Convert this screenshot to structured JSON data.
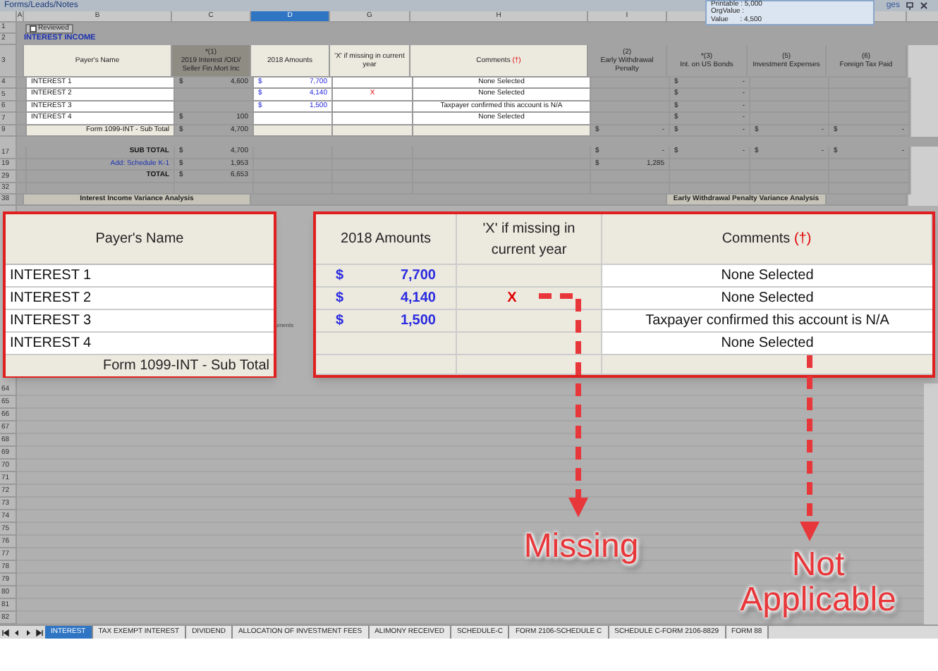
{
  "title_bar": {
    "title": "Forms/Leads/Notes",
    "right_text": "ges"
  },
  "tooltip": {
    "lines": [
      "Printable : 5,000",
      "OrgValue :",
      "Value      : 4,500"
    ]
  },
  "column_headers": [
    {
      "label": "A",
      "selected": false
    },
    {
      "label": "B",
      "selected": false
    },
    {
      "label": "C",
      "selected": false
    },
    {
      "label": "D",
      "selected": true
    },
    {
      "label": "G",
      "selected": false
    },
    {
      "label": "H",
      "selected": false
    },
    {
      "label": "I",
      "selected": false
    }
  ],
  "reviewed": {
    "number": "1",
    "label": "Reviewed",
    "checked": false
  },
  "section_title": {
    "number": "2",
    "text": "INTEREST INCOME"
  },
  "sheet_header": {
    "number": "3",
    "payer": [
      "Payer's Name"
    ],
    "interest_2019": [
      "*(1)",
      "2019 Interest /OID/",
      "Seller Fin.Mort Inc"
    ],
    "amount_2018": [
      "2018 Amounts"
    ],
    "missing": [
      "'X' if missing in current",
      "year"
    ],
    "comment": [
      "Comments"
    ],
    "comment_marker": "(†)",
    "early_withdrawal": [
      "(2)",
      "Early Withdrawal Penalty"
    ],
    "us_bonds": [
      "*(3)",
      "Int. on US Bonds"
    ],
    "investment_expenses": [
      "(5)",
      "Investment Expenses"
    ],
    "foreign_tax": [
      "(6)",
      "Foreign Tax Paid"
    ]
  },
  "sheet_rows": [
    {
      "number": "4",
      "kind": "payer",
      "payer": "INTEREST 1",
      "interest_2019": {
        "cur": "$",
        "amt": "4,600"
      },
      "amount_2018": {
        "cur": "$",
        "amt": "7,700"
      },
      "comment": "None Selected",
      "us_bonds": {
        "cur": "$",
        "amt": "-"
      }
    },
    {
      "number": "5",
      "kind": "payer",
      "payer": "INTEREST 2",
      "amount_2018": {
        "cur": "$",
        "amt": "4,140"
      },
      "missing": "X",
      "comment": "None Selected",
      "us_bonds": {
        "cur": "$",
        "amt": "-"
      }
    },
    {
      "number": "6",
      "kind": "payer",
      "payer": "INTEREST 3",
      "amount_2018": {
        "cur": "$",
        "amt": "1,500"
      },
      "comment": "Taxpayer confirmed this account is N/A",
      "us_bonds": {
        "cur": "$",
        "amt": "-"
      }
    },
    {
      "number": "7",
      "kind": "payer",
      "payer": "INTEREST 4",
      "interest_2019": {
        "cur": "$",
        "amt": "100"
      },
      "comment": "None Selected",
      "us_bonds": {
        "cur": "$",
        "amt": "-"
      }
    },
    {
      "number": "9",
      "kind": "form_subtotal",
      "payer": "Form 1099-INT - Sub Total",
      "interest_2019": {
        "cur": "$",
        "amt": "4,700"
      },
      "early_withdrawal": {
        "cur": "$",
        "amt": "-"
      },
      "us_bonds": {
        "cur": "$",
        "amt": "-"
      },
      "investment_expenses": {
        "cur": "$",
        "amt": "-"
      },
      "foreign_tax": {
        "cur": "$",
        "amt": "-"
      }
    },
    {
      "number": "17",
      "kind": "total",
      "payer": "SUB TOTAL",
      "interest_2019": {
        "cur": "$",
        "amt": "4,700"
      },
      "early_withdrawal": {
        "cur": "$",
        "amt": "-"
      },
      "us_bonds": {
        "cur": "$",
        "amt": "-"
      },
      "investment_expenses": {
        "cur": "$",
        "amt": "-"
      },
      "foreign_tax": {
        "cur": "$",
        "amt": "-"
      }
    },
    {
      "number": "19",
      "kind": "link",
      "payer": "Add: Schedule K-1",
      "interest_2019": {
        "cur": "$",
        "amt": "1,953"
      },
      "early_withdrawal": {
        "cur": "$",
        "amt": "1,285"
      }
    },
    {
      "number": "29",
      "kind": "total",
      "payer": "TOTAL",
      "interest_2019": {
        "cur": "$",
        "amt": "6,653"
      }
    },
    {
      "number": "32",
      "kind": "blank"
    },
    {
      "number": "38",
      "kind": "section",
      "left_heading": "Interest Income Variance Analysis",
      "right_heading": "Early Withdrawal Penalty Variance Analysis"
    }
  ],
  "partial_cell_text": "uments",
  "callout_left": {
    "header": "Payer's Name",
    "rows": [
      "INTEREST 1",
      "INTEREST 2",
      "INTEREST 3",
      "INTEREST 4"
    ],
    "footer": "Form 1099-INT - Sub Total"
  },
  "callout_right": {
    "headers": [
      {
        "text": "2018 Amounts"
      },
      {
        "text": "'X' if missing in current year"
      },
      {
        "text": "Comments",
        "marker": "(†)"
      }
    ],
    "rows": [
      {
        "cur": "$",
        "amt": "7,700",
        "comment": "None Selected"
      },
      {
        "cur": "$",
        "amt": "4,140",
        "missing": "X",
        "comment": "None Selected"
      },
      {
        "cur": "$",
        "amt": "1,500",
        "comment": "Taxpayer confirmed this account is N/A"
      },
      {
        "comment": "None Selected"
      },
      {}
    ]
  },
  "annotations": [
    {
      "kind": "elbow",
      "text": "Missing"
    },
    {
      "kind": "straight",
      "text": "Not Applicable"
    }
  ],
  "bottom_row_numbers": [
    "64",
    "65",
    "66",
    "67",
    "68",
    "69",
    "70",
    "71",
    "72",
    "73",
    "74",
    "75",
    "76",
    "77",
    "78",
    "79",
    "80",
    "81",
    "82"
  ],
  "sheet_tabs": [
    {
      "label": "INTEREST",
      "selected": true
    },
    {
      "label": "TAX EXEMPT INTEREST",
      "selected": false
    },
    {
      "label": "DIVIDEND",
      "selected": false
    },
    {
      "label": "ALLOCATION OF INVESTMENT FEES",
      "selected": false
    },
    {
      "label": "ALIMONY RECEIVED",
      "selected": false
    },
    {
      "label": "SCHEDULE-C",
      "selected": false
    },
    {
      "label": "FORM 2106-SCHEDULE C",
      "selected": false
    },
    {
      "label": "SCHEDULE C-FORM 2106-8829",
      "selected": false
    },
    {
      "label": "FORM 88",
      "selected": false
    }
  ]
}
